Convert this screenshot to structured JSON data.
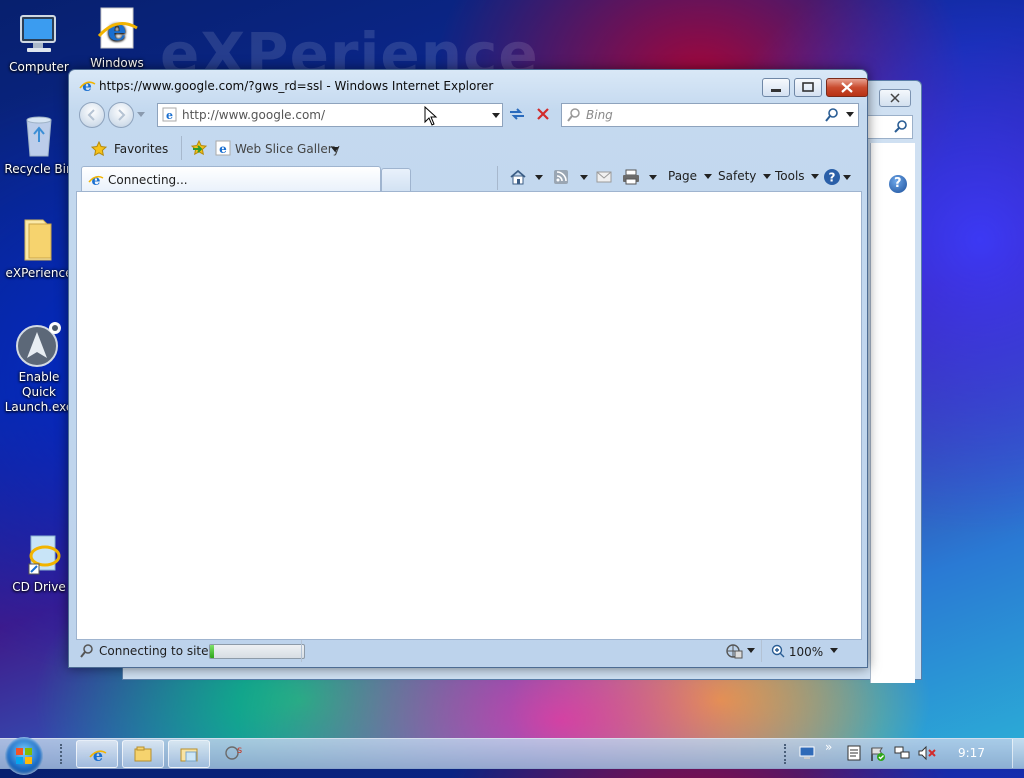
{
  "desktop": {
    "watermark": "eXPerience",
    "icons": [
      {
        "label": "Computer"
      },
      {
        "label": "Windows"
      },
      {
        "label": "Recycle Bin"
      },
      {
        "label": "eXPerience"
      },
      {
        "label": "Enable Quick Launch.exe"
      },
      {
        "label": "CD Drive"
      }
    ]
  },
  "ie": {
    "title": "https://www.google.com/?gws_rd=ssl - Windows Internet Explorer",
    "address": "http://www.google.com/",
    "search_placeholder": "Bing",
    "favorites_label": "Favorites",
    "web_slice_label": "Web Slice Gallery",
    "tab_label": "Connecting...",
    "commands": {
      "page": "Page",
      "safety": "Safety",
      "tools": "Tools"
    },
    "status_text": "Connecting to site .",
    "progress_fraction": 0.04,
    "zoom": "100%"
  },
  "taskbar": {
    "clock": "9:17"
  },
  "colors": {
    "close_button": "#c94b2e",
    "progress_fill": "#2ea61a"
  }
}
